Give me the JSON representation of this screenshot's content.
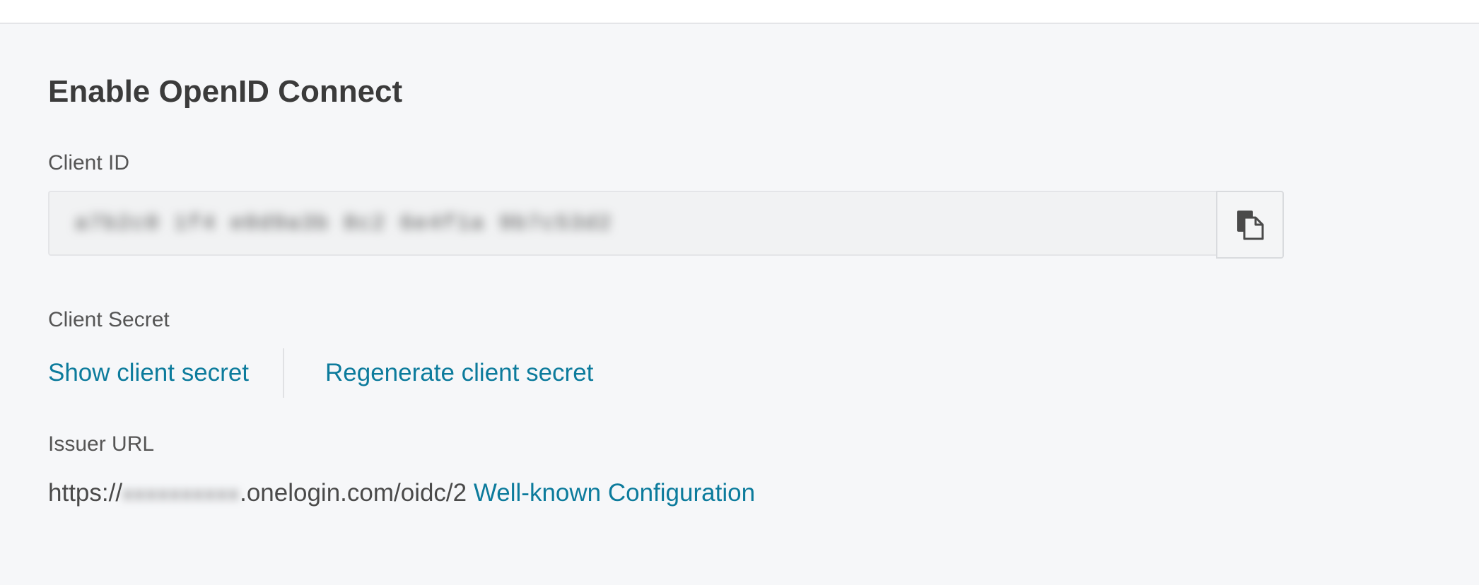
{
  "section": {
    "title": "Enable OpenID Connect"
  },
  "client_id": {
    "label": "Client ID",
    "value": "a7b2c0 1f4 e0d9a3b 8c2 6e4f1a 9b7c53d2",
    "copy_icon": "copy-icon"
  },
  "client_secret": {
    "label": "Client Secret",
    "show_link": "Show client secret",
    "regenerate_link": "Regenerate client secret"
  },
  "issuer": {
    "label": "Issuer URL",
    "prefix": "https://",
    "domain": "xxxxxxxxxx",
    "suffix": ".onelogin.com/oidc/2",
    "well_known_link": "Well-known Configuration"
  },
  "colors": {
    "link": "#0c7b9c",
    "background": "#f6f7f9",
    "heading": "#3b3b3b"
  }
}
